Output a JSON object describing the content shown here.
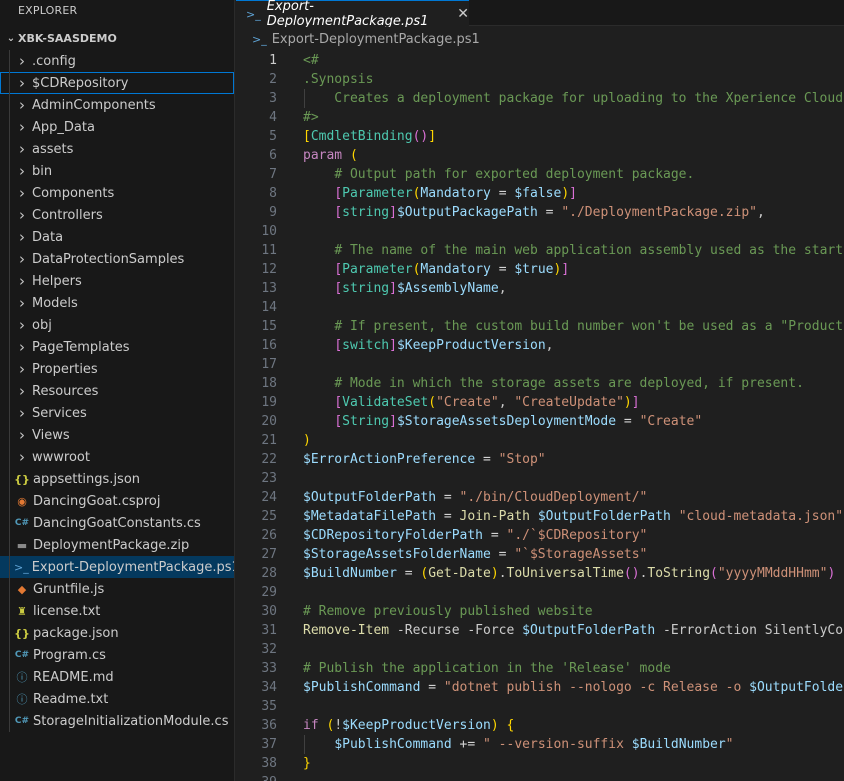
{
  "explorer": {
    "title": "EXPLORER",
    "root": "XBK-SAASDEMO",
    "items": [
      {
        "label": ".config",
        "kind": "folder"
      },
      {
        "label": "$CDRepository",
        "kind": "folder",
        "focused": true
      },
      {
        "label": "AdminComponents",
        "kind": "folder"
      },
      {
        "label": "App_Data",
        "kind": "folder"
      },
      {
        "label": "assets",
        "kind": "folder"
      },
      {
        "label": "bin",
        "kind": "folder"
      },
      {
        "label": "Components",
        "kind": "folder"
      },
      {
        "label": "Controllers",
        "kind": "folder"
      },
      {
        "label": "Data",
        "kind": "folder"
      },
      {
        "label": "DataProtectionSamples",
        "kind": "folder"
      },
      {
        "label": "Helpers",
        "kind": "folder"
      },
      {
        "label": "Models",
        "kind": "folder"
      },
      {
        "label": "obj",
        "kind": "folder"
      },
      {
        "label": "PageTemplates",
        "kind": "folder"
      },
      {
        "label": "Properties",
        "kind": "folder"
      },
      {
        "label": "Resources",
        "kind": "folder"
      },
      {
        "label": "Services",
        "kind": "folder"
      },
      {
        "label": "Views",
        "kind": "folder"
      },
      {
        "label": "wwwroot",
        "kind": "folder"
      },
      {
        "label": "appsettings.json",
        "kind": "json"
      },
      {
        "label": "DancingGoat.csproj",
        "kind": "rss"
      },
      {
        "label": "DancingGoatConstants.cs",
        "kind": "cs"
      },
      {
        "label": "DeploymentPackage.zip",
        "kind": "zip"
      },
      {
        "label": "Export-DeploymentPackage.ps1",
        "kind": "ps",
        "selected": true
      },
      {
        "label": "Gruntfile.js",
        "kind": "grunt"
      },
      {
        "label": "license.txt",
        "kind": "license"
      },
      {
        "label": "package.json",
        "kind": "json"
      },
      {
        "label": "Program.cs",
        "kind": "cs"
      },
      {
        "label": "README.md",
        "kind": "info"
      },
      {
        "label": "Readme.txt",
        "kind": "info"
      },
      {
        "label": "StorageInitializationModule.cs",
        "kind": "cs"
      }
    ]
  },
  "icons": {
    "folder": "chevron-right-icon",
    "json": "json-braces-icon",
    "rss": "rss-icon",
    "cs": "csharp-icon",
    "zip": "zip-file-icon",
    "ps": "powershell-icon",
    "grunt": "grunt-icon",
    "license": "license-icon",
    "info": "info-icon"
  },
  "tab": {
    "label": "Export-DeploymentPackage.ps1",
    "close": "✕"
  },
  "breadcrumb": {
    "file": "Export-DeploymentPackage.ps1"
  },
  "editor": {
    "active_line": 1,
    "lines": [
      {
        "n": 1,
        "tokens": [
          [
            "comment",
            "<#"
          ]
        ]
      },
      {
        "n": 2,
        "tokens": [
          [
            "comment",
            ".Synopsis"
          ]
        ]
      },
      {
        "n": 3,
        "indent": true,
        "tokens": [
          [
            "comment",
            "    Creates a deployment package for uploading to the Xperience Cloud environment."
          ]
        ]
      },
      {
        "n": 4,
        "tokens": [
          [
            "comment",
            "#>"
          ]
        ]
      },
      {
        "n": 5,
        "tokens": [
          [
            "brk",
            "["
          ],
          [
            "attr",
            "CmdletBinding"
          ],
          [
            "brk2",
            "()"
          ],
          [
            "brk",
            "]"
          ]
        ]
      },
      {
        "n": 6,
        "tokens": [
          [
            "kw",
            "param"
          ],
          [
            "plain",
            " "
          ],
          [
            "brk",
            "("
          ]
        ]
      },
      {
        "n": 7,
        "tokens": [
          [
            "plain",
            "    "
          ],
          [
            "comment",
            "# Output path for exported deployment package."
          ]
        ]
      },
      {
        "n": 8,
        "tokens": [
          [
            "plain",
            "    "
          ],
          [
            "brk2",
            "["
          ],
          [
            "attr",
            "Parameter"
          ],
          [
            "brk",
            "("
          ],
          [
            "var",
            "Mandatory"
          ],
          [
            "op",
            " = "
          ],
          [
            "var",
            "$false"
          ],
          [
            "brk",
            ")"
          ],
          [
            "brk2",
            "]"
          ]
        ]
      },
      {
        "n": 9,
        "tokens": [
          [
            "plain",
            "    "
          ],
          [
            "brk2",
            "["
          ],
          [
            "attr",
            "string"
          ],
          [
            "brk2",
            "]"
          ],
          [
            "var",
            "$OutputPackagePath"
          ],
          [
            "op",
            " = "
          ],
          [
            "str",
            "\"./DeploymentPackage.zip\""
          ],
          [
            "plain",
            ","
          ]
        ]
      },
      {
        "n": 10,
        "tokens": []
      },
      {
        "n": 11,
        "tokens": [
          [
            "plain",
            "    "
          ],
          [
            "comment",
            "# The name of the main web application assembly used as the starting point."
          ]
        ]
      },
      {
        "n": 12,
        "tokens": [
          [
            "plain",
            "    "
          ],
          [
            "brk2",
            "["
          ],
          [
            "attr",
            "Parameter"
          ],
          [
            "brk",
            "("
          ],
          [
            "var",
            "Mandatory"
          ],
          [
            "op",
            " = "
          ],
          [
            "var",
            "$true"
          ],
          [
            "brk",
            ")"
          ],
          [
            "brk2",
            "]"
          ]
        ]
      },
      {
        "n": 13,
        "tokens": [
          [
            "plain",
            "    "
          ],
          [
            "brk2",
            "["
          ],
          [
            "attr",
            "string"
          ],
          [
            "brk2",
            "]"
          ],
          [
            "var",
            "$AssemblyName"
          ],
          [
            "plain",
            ","
          ]
        ]
      },
      {
        "n": 14,
        "tokens": []
      },
      {
        "n": 15,
        "tokens": [
          [
            "plain",
            "    "
          ],
          [
            "comment",
            "# If present, the custom build number won't be used as a \"Product version\" suffix."
          ]
        ]
      },
      {
        "n": 16,
        "tokens": [
          [
            "plain",
            "    "
          ],
          [
            "brk2",
            "["
          ],
          [
            "attr",
            "switch"
          ],
          [
            "brk2",
            "]"
          ],
          [
            "var",
            "$KeepProductVersion"
          ],
          [
            "plain",
            ","
          ]
        ]
      },
      {
        "n": 17,
        "tokens": []
      },
      {
        "n": 18,
        "tokens": [
          [
            "plain",
            "    "
          ],
          [
            "comment",
            "# Mode in which the storage assets are deployed, if present."
          ]
        ]
      },
      {
        "n": 19,
        "tokens": [
          [
            "plain",
            "    "
          ],
          [
            "brk2",
            "["
          ],
          [
            "attr",
            "ValidateSet"
          ],
          [
            "brk",
            "("
          ],
          [
            "str",
            "\"Create\""
          ],
          [
            "plain",
            ", "
          ],
          [
            "str",
            "\"CreateUpdate\""
          ],
          [
            "brk",
            ")"
          ],
          [
            "brk2",
            "]"
          ]
        ]
      },
      {
        "n": 20,
        "tokens": [
          [
            "plain",
            "    "
          ],
          [
            "brk2",
            "["
          ],
          [
            "attr",
            "String"
          ],
          [
            "brk2",
            "]"
          ],
          [
            "var",
            "$StorageAssetsDeploymentMode"
          ],
          [
            "op",
            " = "
          ],
          [
            "str",
            "\"Create\""
          ]
        ]
      },
      {
        "n": 21,
        "tokens": [
          [
            "brk",
            ")"
          ]
        ]
      },
      {
        "n": 22,
        "tokens": [
          [
            "var",
            "$ErrorActionPreference"
          ],
          [
            "op",
            " = "
          ],
          [
            "str",
            "\"Stop\""
          ]
        ]
      },
      {
        "n": 23,
        "tokens": []
      },
      {
        "n": 24,
        "tokens": [
          [
            "var",
            "$OutputFolderPath"
          ],
          [
            "op",
            " = "
          ],
          [
            "str",
            "\"./bin/CloudDeployment/\""
          ]
        ]
      },
      {
        "n": 25,
        "tokens": [
          [
            "var",
            "$MetadataFilePath"
          ],
          [
            "op",
            " = "
          ],
          [
            "cmd",
            "Join-Path"
          ],
          [
            "plain",
            " "
          ],
          [
            "var",
            "$OutputFolderPath"
          ],
          [
            "plain",
            " "
          ],
          [
            "str",
            "\"cloud-metadata.json\""
          ]
        ]
      },
      {
        "n": 26,
        "tokens": [
          [
            "var",
            "$CDRepositoryFolderPath"
          ],
          [
            "op",
            " = "
          ],
          [
            "str",
            "\"./`$CDRepository\""
          ]
        ]
      },
      {
        "n": 27,
        "tokens": [
          [
            "var",
            "$StorageAssetsFolderName"
          ],
          [
            "op",
            " = "
          ],
          [
            "str",
            "\"`$StorageAssets\""
          ]
        ]
      },
      {
        "n": 28,
        "tokens": [
          [
            "var",
            "$BuildNumber"
          ],
          [
            "op",
            " = "
          ],
          [
            "brk",
            "("
          ],
          [
            "cmd",
            "Get-Date"
          ],
          [
            "brk",
            ")"
          ],
          [
            "plain",
            "."
          ],
          [
            "cmd",
            "ToUniversalTime"
          ],
          [
            "brk2",
            "()"
          ],
          [
            "plain",
            "."
          ],
          [
            "cmd",
            "ToString"
          ],
          [
            "brk2",
            "("
          ],
          [
            "str",
            "\"yyyyMMddHHmm\""
          ],
          [
            "brk2",
            ")"
          ]
        ]
      },
      {
        "n": 29,
        "tokens": []
      },
      {
        "n": 30,
        "tokens": [
          [
            "comment",
            "# Remove previously published website"
          ]
        ]
      },
      {
        "n": 31,
        "tokens": [
          [
            "cmd",
            "Remove-Item"
          ],
          [
            "plain",
            " -Recurse -Force "
          ],
          [
            "var",
            "$OutputFolderPath"
          ],
          [
            "plain",
            " -ErrorAction SilentlyContinue"
          ]
        ]
      },
      {
        "n": 32,
        "tokens": []
      },
      {
        "n": 33,
        "tokens": [
          [
            "comment",
            "# Publish the application in the 'Release' mode"
          ]
        ]
      },
      {
        "n": 34,
        "tokens": [
          [
            "var",
            "$PublishCommand"
          ],
          [
            "op",
            " = "
          ],
          [
            "str",
            "\"dotnet publish --nologo -c Release -o "
          ],
          [
            "var",
            "$OutputFolderPath"
          ],
          [
            "str",
            "\""
          ]
        ]
      },
      {
        "n": 35,
        "tokens": []
      },
      {
        "n": 36,
        "tokens": [
          [
            "kw",
            "if"
          ],
          [
            "plain",
            " "
          ],
          [
            "brk",
            "("
          ],
          [
            "plain",
            "!"
          ],
          [
            "var",
            "$KeepProductVersion"
          ],
          [
            "brk",
            ")"
          ],
          [
            "plain",
            " "
          ],
          [
            "brk",
            "{"
          ]
        ]
      },
      {
        "n": 37,
        "indent": true,
        "tokens": [
          [
            "plain",
            "    "
          ],
          [
            "var",
            "$PublishCommand"
          ],
          [
            "op",
            " += "
          ],
          [
            "str",
            "\" --version-suffix "
          ],
          [
            "var",
            "$BuildNumber"
          ],
          [
            "str",
            "\""
          ]
        ]
      },
      {
        "n": 38,
        "tokens": [
          [
            "brk",
            "}"
          ]
        ]
      },
      {
        "n": 39,
        "tokens": []
      }
    ]
  }
}
